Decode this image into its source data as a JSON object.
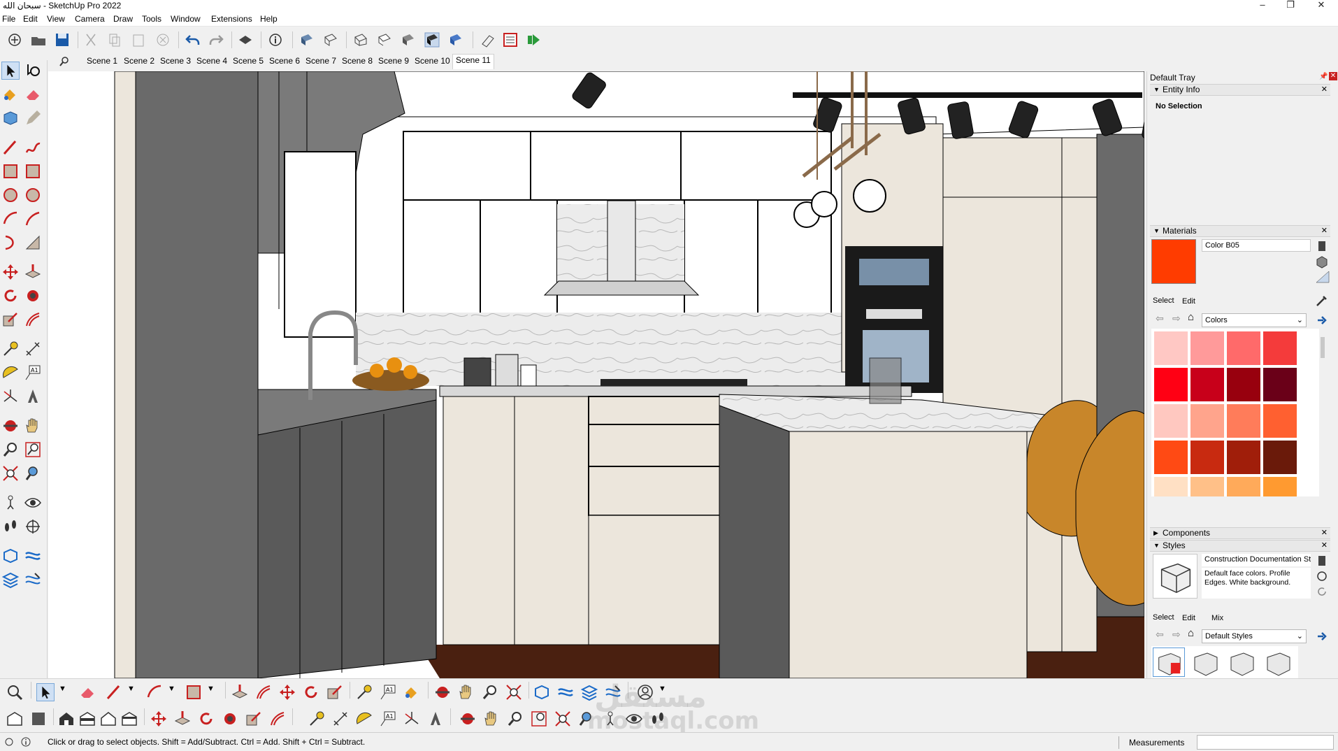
{
  "window": {
    "title": "سبحان الله - SketchUp Pro 2022"
  },
  "menu": [
    "File",
    "Edit",
    "View",
    "Camera",
    "Draw",
    "Tools",
    "Window",
    "Extensions",
    "Help"
  ],
  "scenes": [
    "Scene 1",
    "Scene 2",
    "Scene 3",
    "Scene 4",
    "Scene 5",
    "Scene 6",
    "Scene 7",
    "Scene 8",
    "Scene 9",
    "Scene 10",
    "Scene 11"
  ],
  "active_scene": "Scene 11",
  "tray": {
    "title": "Default Tray",
    "entity_info": {
      "title": "Entity Info",
      "value": "No Selection"
    },
    "materials": {
      "title": "Materials",
      "name": "Color B05",
      "tabs": [
        "Select",
        "Edit"
      ],
      "library": "Colors",
      "current_color": "#ff3c00",
      "swatches": [
        "#ffc8c4",
        "#ff9a9a",
        "#ff6a6a",
        "#f43b3b",
        "#ff0014",
        "#c8001a",
        "#98000e",
        "#6a0018",
        "#ffc8c0",
        "#ffa48c",
        "#ff7c5a",
        "#ff6030",
        "#ff4a14",
        "#c82a10",
        "#a01e0a",
        "#6a1a0a",
        "#ffe0c4",
        "#ffc088",
        "#ffaa5a",
        "#ff9a30",
        "#ff7a10",
        "#e05a10",
        "#b84a10",
        "#8a3010"
      ]
    },
    "components": {
      "title": "Components"
    },
    "styles": {
      "title": "Styles",
      "name": "Construction Documentation St",
      "description": "Default face colors. Profile Edges. White background.",
      "tabs": [
        "Select",
        "Edit",
        "Mix"
      ],
      "library": "Default Styles"
    }
  },
  "status": {
    "hint": "Click or drag to select objects. Shift = Add/Subtract. Ctrl = Add. Shift + Ctrl = Subtract.",
    "measurements_label": "Measurements",
    "measurements_value": ""
  },
  "watermark": {
    "line1": "مستقل",
    "line2": "mostaql.com"
  },
  "colors": {
    "accent": "#ff3c00",
    "toolbar_bg": "#f0f0f0",
    "cabinet_dark": "#6a6a6a",
    "cabinet_white": "#ffffff",
    "cream": "#ece6dc",
    "chair": "#c8862a"
  }
}
